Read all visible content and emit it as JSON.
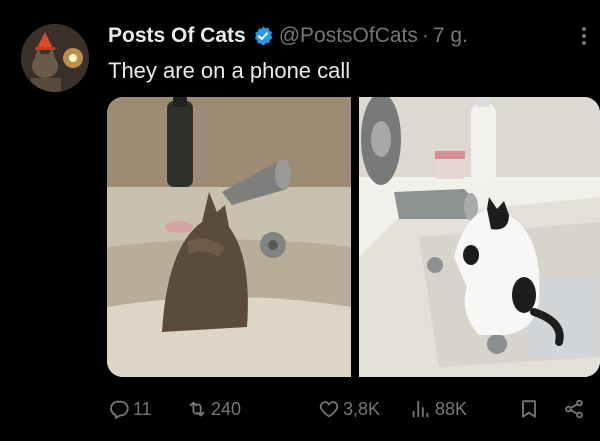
{
  "author": {
    "name": "Posts Of Cats",
    "handle": "@PostsOfCats",
    "separator": "·",
    "time": "7 g."
  },
  "tweet": {
    "text": "They are on a phone call"
  },
  "media": {
    "count": 2
  },
  "actions": {
    "replies": "11",
    "reposts": "240",
    "likes": "3,8K",
    "views": "88K"
  },
  "colors": {
    "background": "#000000",
    "text": "#e7e9ea",
    "muted": "#71767b",
    "verified": "#1d9bf0"
  },
  "icons": [
    "verified-badge-icon",
    "more-icon",
    "reply-icon",
    "repost-icon",
    "like-icon",
    "views-icon",
    "bookmark-icon",
    "share-icon"
  ]
}
